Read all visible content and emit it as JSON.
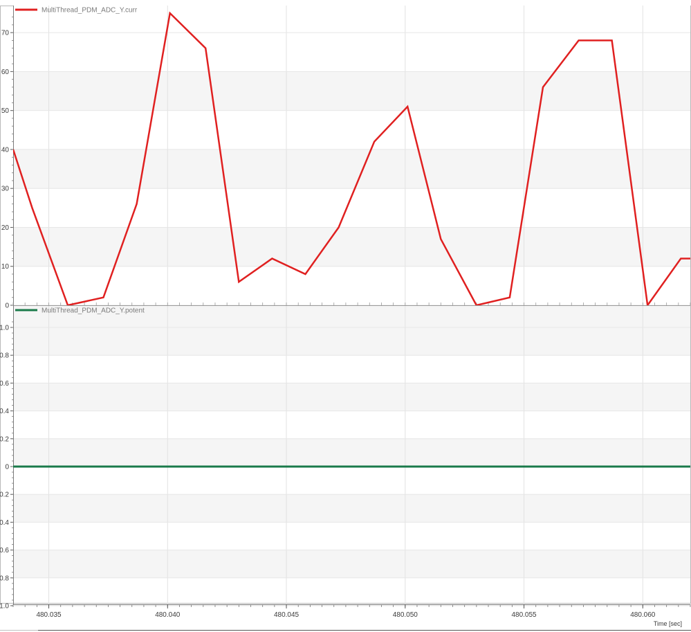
{
  "chart_data": [
    {
      "type": "line",
      "legend": "MultiThread_PDM_ADC_Y.curr",
      "color": "#e02020",
      "ylim": [
        0,
        75
      ],
      "yticks": [
        0,
        10,
        20,
        30,
        40,
        50,
        60,
        70
      ],
      "ytick_labels": [
        "0",
        "10",
        "20",
        "30",
        "40",
        "50",
        "60",
        "70"
      ],
      "xlim": [
        480.0335,
        480.062
      ],
      "grid": true,
      "x": [
        480.0335,
        480.0343,
        480.0358,
        480.0373,
        480.0387,
        480.0401,
        480.0416,
        480.043,
        480.0444,
        480.0458,
        480.0472,
        480.0487,
        480.0501,
        480.0515,
        480.053,
        480.0544,
        480.0558,
        480.0573,
        480.0587,
        480.0602,
        480.0616,
        480.062
      ],
      "y": [
        40,
        25,
        0,
        2,
        26,
        75,
        66,
        6,
        12,
        8,
        20,
        42,
        51,
        17,
        0,
        2,
        56,
        68,
        68,
        0,
        12,
        12
      ]
    },
    {
      "type": "line",
      "legend": "MultiThread_PDM_ADC_Y.potent",
      "color": "#1a7a4a",
      "ylim": [
        -1.0,
        1.1
      ],
      "yticks": [
        1.0,
        0.8,
        0.6,
        0.4,
        0.2,
        0,
        -0.2,
        -0.4,
        -0.6,
        -0.8,
        -1.0
      ],
      "ytick_labels": [
        "1.0",
        "0.8",
        "0.6",
        "0.4",
        "0.2",
        "0",
        "0.2",
        "0.4",
        "0.6",
        "0.8",
        "1.0"
      ],
      "xlim": [
        480.0335,
        480.062
      ],
      "grid": true,
      "x": [
        480.0335,
        480.062
      ],
      "y": [
        0,
        0
      ]
    }
  ],
  "x_axis": {
    "ticks": [
      480.035,
      480.04,
      480.045,
      480.05,
      480.055,
      480.06
    ],
    "tick_labels": [
      "480.035",
      "480.040",
      "480.045",
      "480.050",
      "480.055",
      "480.060"
    ],
    "label": "Time [sec]"
  }
}
